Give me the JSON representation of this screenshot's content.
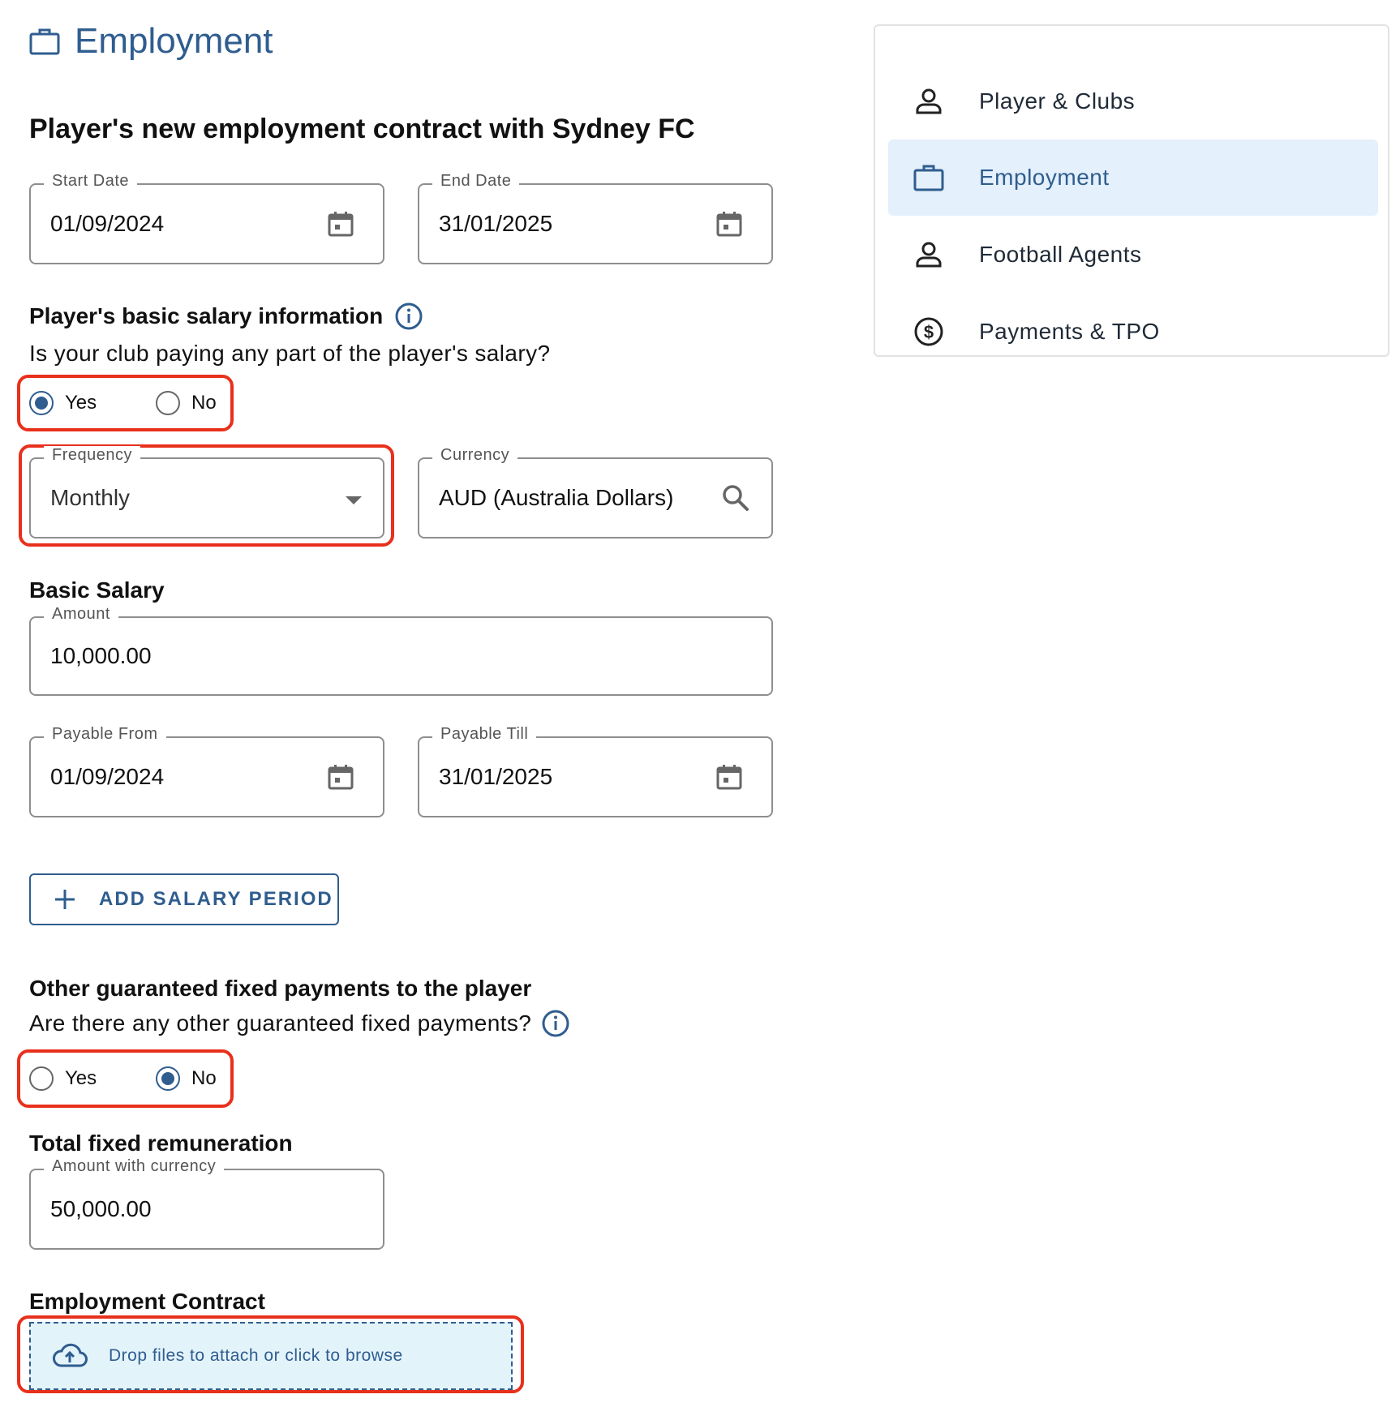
{
  "header": {
    "title": "Employment",
    "icon": "briefcase-icon"
  },
  "section_title": "Player's new employment contract with Sydney FC",
  "contract_dates": {
    "start": {
      "label": "Start Date",
      "value": "01/09/2024"
    },
    "end": {
      "label": "End Date",
      "value": "31/01/2025"
    }
  },
  "salary": {
    "heading": "Player's basic salary information",
    "question": "Is your club paying any part of the player's salary?",
    "options": [
      "Yes",
      "No"
    ],
    "selected": "Yes",
    "frequency": {
      "label": "Frequency",
      "value": "Monthly"
    },
    "currency": {
      "label": "Currency",
      "value": "AUD (Australia Dollars)"
    },
    "basic_heading": "Basic Salary",
    "amount": {
      "label": "Amount",
      "value": "10,000.00"
    },
    "payable_from": {
      "label": "Payable From",
      "value": "01/09/2024"
    },
    "payable_till": {
      "label": "Payable Till",
      "value": "31/01/2025"
    },
    "add_button": "ADD SALARY PERIOD"
  },
  "other_payments": {
    "heading": "Other guaranteed fixed payments to the player",
    "question": "Are there any other guaranteed fixed payments?",
    "options": [
      "Yes",
      "No"
    ],
    "selected": "No"
  },
  "total": {
    "heading": "Total fixed remuneration",
    "field": {
      "label": "Amount with currency",
      "value": "50,000.00"
    }
  },
  "contract_upload": {
    "heading": "Employment Contract",
    "dropzone_text": "Drop files to attach or click to browse"
  },
  "sidebar": {
    "items": [
      {
        "label": "Player & Clubs",
        "icon": "person-icon",
        "active": false
      },
      {
        "label": "Employment",
        "icon": "briefcase-icon",
        "active": true
      },
      {
        "label": "Football Agents",
        "icon": "person-icon",
        "active": false
      },
      {
        "label": "Payments & TPO",
        "icon": "dollar-circle-icon",
        "active": false
      }
    ]
  },
  "colors": {
    "accent": "#2f5d8f",
    "highlight": "#e8301c",
    "active_bg": "#e4f0fb",
    "dropzone_bg": "#e3f3fa"
  }
}
